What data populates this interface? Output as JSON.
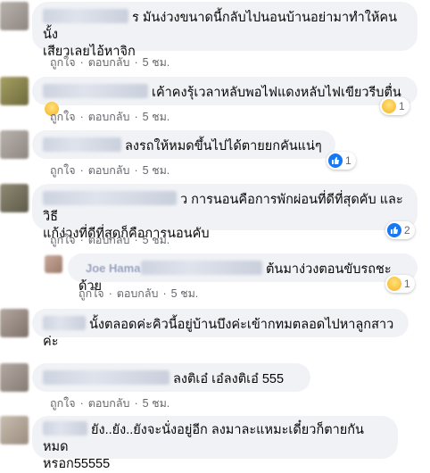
{
  "actions": {
    "like": "ถูกใจ",
    "reply": "ตอบกลับ",
    "separator": "·"
  },
  "comments": [
    {
      "text_line1": "ร มันง่วงขนาดนี้กลับไปนอนบ้านอย่ามาทำให้คนนั้ง",
      "text_line2": "เสียวเลยไอ้หาจิก",
      "time": "5 ชม."
    },
    {
      "text_line1": "เค้าคงรุ้เวลาหลับพอไฟแดงหลับไฟเขียวรีบตื่น",
      "time": "5 ชม.",
      "reaction_count": "1"
    },
    {
      "text_line1": "ลงรถให้หมดขึ้นไปได้ตายยกคันแน่ๆ",
      "time": "5 ชม.",
      "reaction_count": "1"
    },
    {
      "text_line1": "ว การนอนคือการพักผ่อนที่ดีที่สุดคับ และวิธี",
      "text_line2": "แก้ง่วงที่ดีที่สุดก็คือการนอนคับ",
      "time": "5 ชม.",
      "reaction_count": "2"
    },
    {
      "name_partial": "Joe Hama",
      "text_line1": "ต้นมาง่วงตอนขับรถชะด้วย",
      "time": "5 ชม.",
      "reaction_count": "1"
    },
    {
      "text_line1": "นั้งตลอดค่ะคิวนี้อยู่บ้านบึงค่ะเข้ากทมตลอดไปหาลูกสาวค่ะ"
    },
    {
      "text_line1": "ลงติเอ๋ เอ๋ลงติเอ๋ 555",
      "time": "5 ชม."
    },
    {
      "text_line1": "ยัง..ยัง..ยังจะนั่งอยู่อีก ลงมาละแหมะเดี๋ยวก็ตายกันหมด",
      "text_line2": "หรอก55555"
    }
  ]
}
